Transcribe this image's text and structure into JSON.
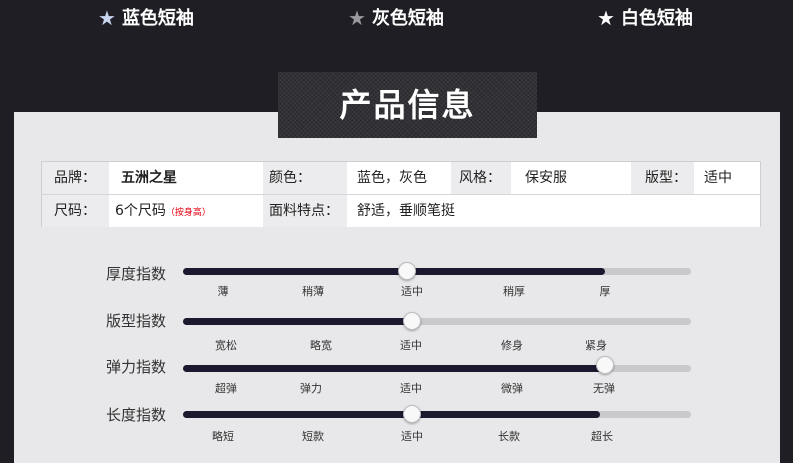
{
  "tabs": [
    {
      "label": "蓝色短袖",
      "star_color": "#c6d4ee"
    },
    {
      "label": "灰色短袖",
      "star_color": "#9a9a9e"
    },
    {
      "label": "白色短袖",
      "star_color": "#ffffff"
    }
  ],
  "title": "产品信息",
  "info": {
    "brand_label": "品牌：",
    "brand": "五洲之星",
    "color_label": "颜色：",
    "color": "蓝色，灰色",
    "style_label": "风格：",
    "style": "保安服",
    "fit_label": "版型：",
    "fit": "适中",
    "size_label": "尺码：",
    "size": "6个尺码",
    "size_note": "（按身高）",
    "fabric_label": "面料特点：",
    "fabric": "舒适，垂顺笔挺"
  },
  "sliders": [
    {
      "label": "厚度指数",
      "ticks": [
        "薄",
        "稍薄",
        "适中",
        "稍厚",
        "厚"
      ],
      "fill_percent": 83,
      "knob_percent": 44
    },
    {
      "label": "版型指数",
      "ticks": [
        "宽松",
        "略宽",
        "适中",
        "修身",
        "紧身"
      ],
      "fill_percent": 45,
      "knob_percent": 45
    },
    {
      "label": "弹力指数",
      "ticks": [
        "超弹",
        "弹力",
        "适中",
        "微弹",
        "无弹"
      ],
      "fill_percent": 83,
      "knob_percent": 83
    },
    {
      "label": "长度指数",
      "ticks": [
        "略短",
        "短款",
        "适中",
        "长款",
        "超长"
      ],
      "fill_percent": 82,
      "knob_percent": 45
    }
  ],
  "colors": {
    "fill": "#1b1830",
    "track": "#c9c9cc",
    "header_bg": "#1f1e24",
    "panel_bg": "#e8e8ea"
  }
}
